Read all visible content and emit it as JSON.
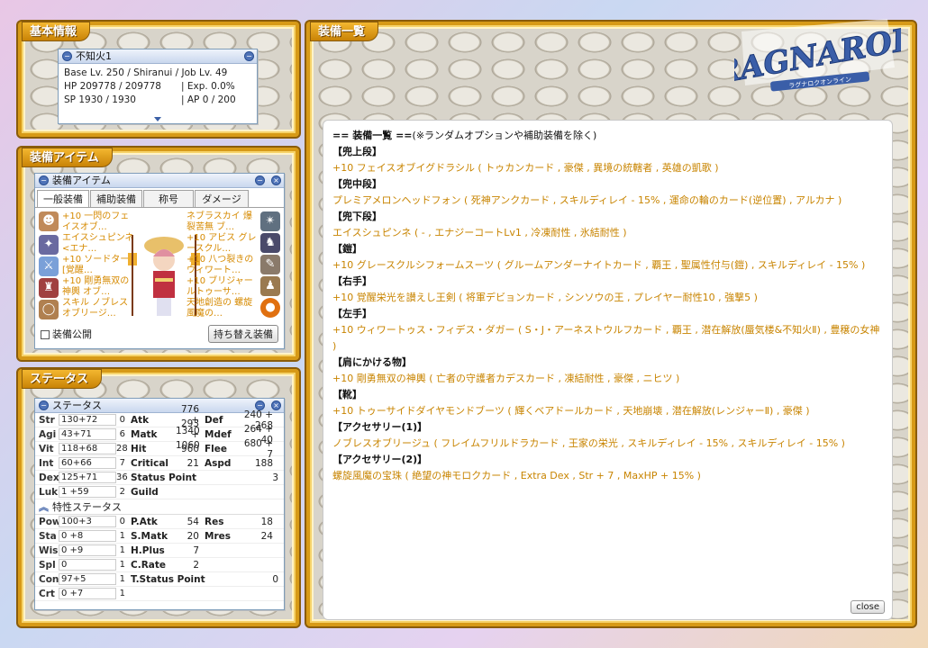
{
  "basic_panel": {
    "label": "基本情報",
    "window_title": "不知火1",
    "line1": "Base Lv. 250 / Shiranui / Job Lv. 49",
    "hp": "HP 209778 / 209778",
    "exp": "| Exp. 0.0%",
    "sp": "SP 1930 / 1930",
    "ap": "| AP 0 / 200"
  },
  "equip_panel": {
    "label": "装備アイテム",
    "window_title": "装備アイテム",
    "tabs": [
      "一般装備",
      "補助装備",
      "称号",
      "ダメージ"
    ],
    "left_slots": [
      "+10 一閃のフェイスオブ…",
      "エイスシュピンネ<エナ…",
      "+10 ソードター[覚醒…",
      "+10 剛勇無双の神輿 オブ…",
      "スキル ノブレスオブリージ…"
    ],
    "right_slots": [
      "ネブラスカイ 爆裂苦無 ブ…",
      "+10 アビス グレースクル…",
      "+10 八つ裂きのウィワート…",
      "+10 ブリジャールトゥーサ…",
      "天地創造の 螺旋風魔の…"
    ],
    "public_label": "装備公開",
    "swap_button": "持ち替え装備"
  },
  "status_panel": {
    "label": "ステータス",
    "window_title": "ステータス",
    "base_stats": [
      {
        "k": "Str",
        "v": "130+72",
        "p": "0"
      },
      {
        "k": "Agi",
        "v": "43+71",
        "p": "6"
      },
      {
        "k": "Vit",
        "v": "118+68",
        "p": "28"
      },
      {
        "k": "Int",
        "v": "60+66",
        "p": "7"
      },
      {
        "k": "Dex",
        "v": "125+71",
        "p": "36"
      },
      {
        "k": "Luk",
        "v": "1 +59",
        "p": "2"
      }
    ],
    "mid_stats": [
      {
        "k": "Atk",
        "v": "776 + 1340"
      },
      {
        "k": "Matk",
        "v": "293 + 1060"
      },
      {
        "k": "Hit",
        "v": "960"
      },
      {
        "k": "Critical",
        "v": "21"
      },
      {
        "k": "Status Point",
        "v": "3"
      },
      {
        "k": "Guild",
        "v": ""
      }
    ],
    "right_stats": [
      {
        "k": "Def",
        "v": "240 + 268"
      },
      {
        "k": "Mdef",
        "v": "264 + 40"
      },
      {
        "k": "Flee",
        "v": "680 + 7"
      },
      {
        "k": "Aspd",
        "v": "188"
      }
    ],
    "trait_label": "特性ステータス",
    "trait_stats": [
      {
        "k": "Pow",
        "v": "100+3",
        "p": "0"
      },
      {
        "k": "Sta",
        "v": "0 +8",
        "p": "1"
      },
      {
        "k": "Wis",
        "v": "0 +9",
        "p": "1"
      },
      {
        "k": "Spl",
        "v": "0",
        "p": "1"
      },
      {
        "k": "Con",
        "v": "97+5",
        "p": "1"
      },
      {
        "k": "Crt",
        "v": "0 +7",
        "p": "1"
      }
    ],
    "trait_mid": [
      {
        "k": "P.Atk",
        "v": "54"
      },
      {
        "k": "S.Matk",
        "v": "20"
      },
      {
        "k": "H.Plus",
        "v": "7"
      },
      {
        "k": "C.Rate",
        "v": "2"
      },
      {
        "k": "T.Status Point",
        "v": "0"
      }
    ],
    "trait_right": [
      {
        "k": "Res",
        "v": "18"
      },
      {
        "k": "Mres",
        "v": "24"
      }
    ]
  },
  "list_panel": {
    "label": "装備一覧",
    "header": "== 装備一覧 ==",
    "header_note": "(※ランダムオプションや補助装備を除く)",
    "entries": [
      {
        "slot": "【兜上段】",
        "item": "+10 フェイスオブイグドラシル ( トゥカンカード , 豪傑 , 異境の統轄者 , 英雄の凱歌 )"
      },
      {
        "slot": "【兜中段】",
        "item": "プレミアメロンヘッドフォン ( 死神アンクカード , スキルディレイ - 15% , 運命の輪のカード(逆位置) , アルカナ )"
      },
      {
        "slot": "【兜下段】",
        "item": "エイスシュピンネ ( - , エナジーコートLv1 , 冷凍耐性 , 氷結耐性 )"
      },
      {
        "slot": "【鎧】",
        "item": "+10 グレースクルシフォームスーツ ( グルームアンダーナイトカード , 覇王 , 聖属性付与(鎧) , スキルディレイ - 15% )"
      },
      {
        "slot": "【右手】",
        "item": "+10 覚醒栄光を讃えし王剣 ( 将軍デビョンカード , シンソウの王 , プレイヤー耐性10 , 強撃5 )"
      },
      {
        "slot": "【左手】",
        "item": "+10 ウィワートゥス・フィデス・ダガー ( S・J・アーネストウルフカード , 覇王 , 潜在解放(蜃気楼&不知火Ⅱ) , 豊穣の女神 )"
      },
      {
        "slot": "【肩にかける物】",
        "item": "+10 剛勇無双の神輿 ( 亡者の守護者カデスカード , 凍結耐性 , 豪傑 , ニヒツ )"
      },
      {
        "slot": "【靴】",
        "item": "+10 トゥーサイドダイヤモンドブーツ ( 輝くベアドールカード , 天地崩壊 , 潜在解放(レンジャーⅡ) , 豪傑 )"
      },
      {
        "slot": "【アクセサリー(1)】",
        "item": "ノブレスオブリージュ ( フレイムフリルドラカード , 王家の栄光 , スキルディレイ - 15% , スキルディレイ - 15% )"
      },
      {
        "slot": "【アクセサリー(2)】",
        "item": "螺旋風魔の宝珠 ( 絶望の神モロクカード , Extra Dex , Str + 7 , MaxHP + 15% )"
      }
    ],
    "close_label": "close"
  },
  "logo": {
    "text": "RAGNAROK",
    "sub": "ラグナロクオンライン"
  },
  "colors": {
    "frame": "#d79a17",
    "item_text": "#c88400",
    "window_border": "#7f9db9"
  }
}
